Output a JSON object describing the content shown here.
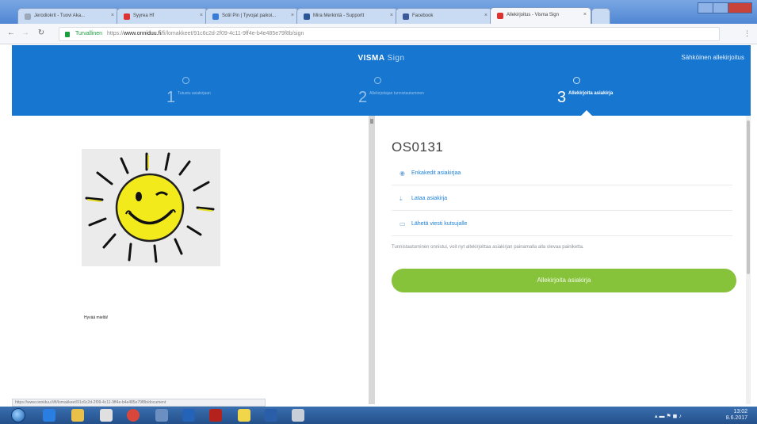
{
  "browser": {
    "tabs": [
      {
        "label": "Jerodiokrit - Tuovi Aka..."
      },
      {
        "label": "Syyrea Hf"
      },
      {
        "label": "Sotil Pin | Tyvojat paikoi..."
      },
      {
        "label": "Mira Merkintä - Supportt"
      },
      {
        "label": "Facebook"
      },
      {
        "label": "Allekirjoitus - Visma Sign"
      }
    ],
    "address": {
      "secure_label": "Turvallinen",
      "url_prefix": "https://",
      "url_host": "www.onniduu.fi",
      "url_path": "/fi/lomakkeet/91c6c2d-2f09-4c11-9ff4e-b4e485e79f8b/sign"
    }
  },
  "header": {
    "brand": "VISMA",
    "brand_sub": "Sign",
    "link": "Sähköinen allekirjoitus",
    "steps": [
      {
        "number": "1",
        "label": "Tutustu asiakirjaan"
      },
      {
        "number": "2",
        "label": "Allekirjoitajan tunnistautuminen"
      },
      {
        "number": "3",
        "label": "Allekirjoita asiakirja"
      }
    ]
  },
  "document": {
    "caption": "Hyvää mieltä!"
  },
  "sidebar": {
    "title": "OS0131",
    "actions": [
      {
        "label": "Enkakedit asiakirjaa"
      },
      {
        "label": "Lataa asiakirja"
      },
      {
        "label": "Lähetä viesti kutsujalle"
      }
    ],
    "help": "Tunnistautuminen onnistui, voit nyt allekirjoittaa asiakirjan painamalla alla olevaa painiketta.",
    "sign_button": "Allekirjoita asiakirja"
  },
  "status_url": "https://www.onniduu.fi/fi/lomakkeet/91c6c2d-2f09-4c11-9ff4e-b4e485e79f8b/document",
  "taskbar": {
    "time": "13:02",
    "date": "8.6.2017"
  }
}
